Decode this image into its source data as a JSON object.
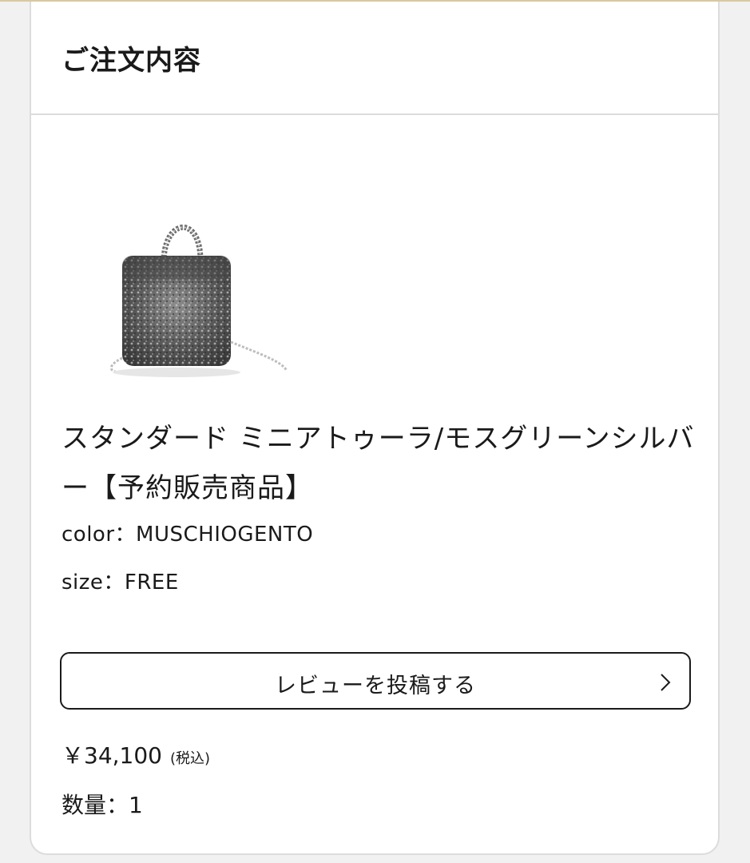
{
  "order": {
    "title": "ご注文内容"
  },
  "product": {
    "image_icon": "product-bag-image",
    "name": "スタンダード ミニアトゥーラ/モスグリーンシルバー【予約販売商品】",
    "color_text": "color：MUSCHIOGENTO",
    "size_text": "size：FREE",
    "price": "￥34,100",
    "tax_note": "(税込)",
    "quantity_text": "数量：1"
  },
  "review": {
    "button_label": "レビューを投稿する",
    "chevron_icon": "chevron-right-icon"
  },
  "colors": {
    "accent_rule": "#d9c9a0",
    "border": "#dcdcdc",
    "text": "#1a1a1a"
  }
}
